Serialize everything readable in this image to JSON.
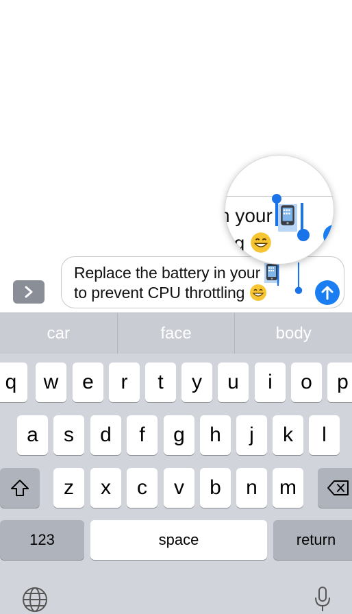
{
  "compose": {
    "line1": "Replace the battery in your",
    "line2": "to prevent CPU throttling",
    "selected_emoji_name": "mobile-phone-icon",
    "trailing_emoji_name": "grinning-face-icon",
    "selection_color": "#b9d5f6",
    "send_color": "#1a7ef2"
  },
  "magnifier": {
    "line1": "n your",
    "line2": "ing"
  },
  "predictions": [
    "car",
    "face",
    "body"
  ],
  "keyboard": {
    "row1": [
      "q",
      "w",
      "e",
      "r",
      "t",
      "y",
      "u",
      "i",
      "o",
      "p"
    ],
    "row2": [
      "a",
      "s",
      "d",
      "f",
      "g",
      "h",
      "j",
      "k",
      "l"
    ],
    "row3": [
      "z",
      "x",
      "c",
      "v",
      "b",
      "n",
      "m"
    ],
    "numbers_label": "123",
    "space_label": "space",
    "return_label": "return"
  }
}
